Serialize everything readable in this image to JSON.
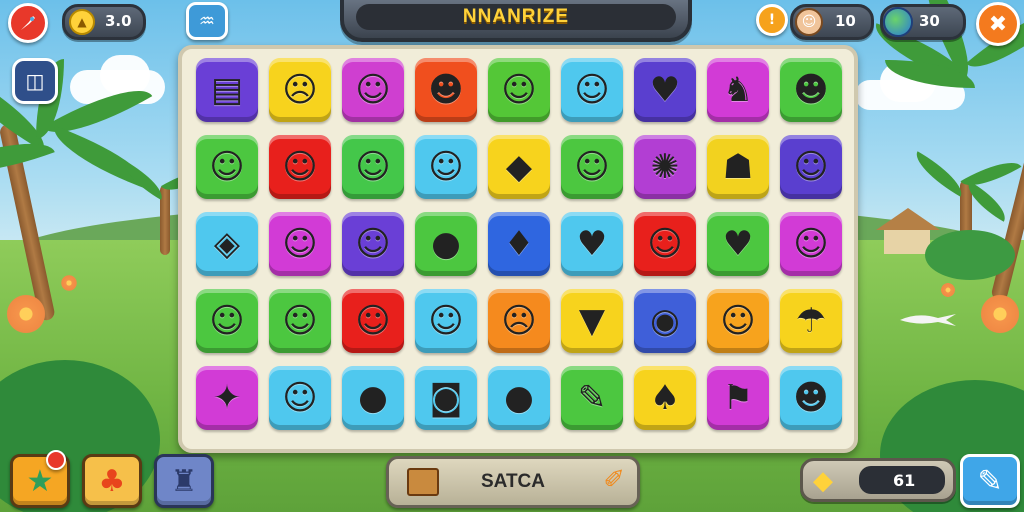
{
  "hud": {
    "coins_value": "3.0",
    "title": "NNANRIZE",
    "lives_value": "10",
    "gems_value": "30",
    "bottom_value": "61"
  },
  "search": {
    "label": "SATCA"
  },
  "icons": {
    "rocket": "rocket-icon",
    "coin": "coin-icon",
    "water": "water-drop-icon",
    "menu": "menu-icon",
    "info": "info-icon",
    "avatar": "avatar-icon",
    "globe": "globe-icon",
    "close": "close-icon",
    "star": "star-icon",
    "tree": "tree-icon",
    "monster": "monster-icon",
    "cheese": "cheese-icon",
    "pencil": "pencil-icon",
    "crate": "crate-icon",
    "carrot": "carrot-icon"
  },
  "board": {
    "rows": [
      [
        {
          "color": "#6a3fd6",
          "glyph": "▤"
        },
        {
          "color": "#f7d31d",
          "glyph": "☹"
        },
        {
          "color": "#cf3fd0",
          "glyph": "☺"
        },
        {
          "color": "#f04f1e",
          "glyph": "☻"
        },
        {
          "color": "#54c737",
          "glyph": "☺"
        },
        {
          "color": "#4fc8ee",
          "glyph": "☺"
        },
        {
          "color": "#5a3fcf",
          "glyph": "♥"
        },
        {
          "color": "#d23bd6",
          "glyph": "♞"
        },
        {
          "color": "#4cc740",
          "glyph": "☻"
        }
      ],
      [
        {
          "color": "#4cc740",
          "glyph": "☺"
        },
        {
          "color": "#e8201c",
          "glyph": "☺"
        },
        {
          "color": "#44c74a",
          "glyph": "☺"
        },
        {
          "color": "#4fc8ee",
          "glyph": "☺"
        },
        {
          "color": "#f7d31d",
          "glyph": "◆"
        },
        {
          "color": "#4cc740",
          "glyph": "☺"
        },
        {
          "color": "#b23ed3",
          "glyph": "✺"
        },
        {
          "color": "#f2d21f",
          "glyph": "☗"
        },
        {
          "color": "#5a3fcf",
          "glyph": "☺"
        }
      ],
      [
        {
          "color": "#4fc8ee",
          "glyph": "◈"
        },
        {
          "color": "#d23bd6",
          "glyph": "☺"
        },
        {
          "color": "#6a3fd6",
          "glyph": "☺"
        },
        {
          "color": "#4cc740",
          "glyph": "●"
        },
        {
          "color": "#2f66e0",
          "glyph": "♦"
        },
        {
          "color": "#4fc8ee",
          "glyph": "♥"
        },
        {
          "color": "#e8201c",
          "glyph": "☺"
        },
        {
          "color": "#4cc740",
          "glyph": "♥"
        },
        {
          "color": "#d23bd6",
          "glyph": "☺"
        }
      ],
      [
        {
          "color": "#4cc740",
          "glyph": "☺"
        },
        {
          "color": "#4cc740",
          "glyph": "☺"
        },
        {
          "color": "#e8201c",
          "glyph": "☺"
        },
        {
          "color": "#4fc8ee",
          "glyph": "☺"
        },
        {
          "color": "#f58a1e",
          "glyph": "☹"
        },
        {
          "color": "#f7d31d",
          "glyph": "▼"
        },
        {
          "color": "#3f5fd9",
          "glyph": "◉"
        },
        {
          "color": "#f7a31d",
          "glyph": "☺"
        },
        {
          "color": "#f7d31d",
          "glyph": "☂"
        }
      ],
      [
        {
          "color": "#d23bd6",
          "glyph": "✦"
        },
        {
          "color": "#4fc8ee",
          "glyph": "☺"
        },
        {
          "color": "#4fc8ee",
          "glyph": "●"
        },
        {
          "color": "#4fc8ee",
          "glyph": "◙"
        },
        {
          "color": "#4fc8ee",
          "glyph": "●"
        },
        {
          "color": "#4cc740",
          "glyph": "✎"
        },
        {
          "color": "#f7d31d",
          "glyph": "♠"
        },
        {
          "color": "#d23bd6",
          "glyph": "⚑"
        },
        {
          "color": "#4fc8ee",
          "glyph": "☻"
        }
      ]
    ]
  }
}
